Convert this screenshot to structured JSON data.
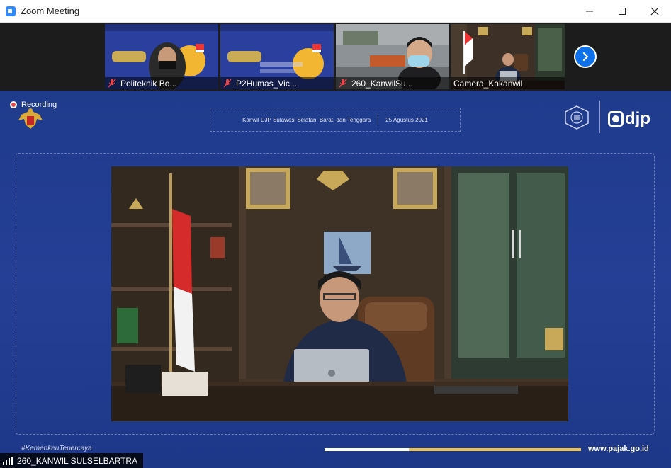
{
  "window": {
    "title": "Zoom Meeting",
    "controls": [
      "minimize",
      "maximize",
      "close"
    ]
  },
  "thumbnails": [
    {
      "name": "Politeknik Bo...",
      "muted": true
    },
    {
      "name": "P2Humas_Vic...",
      "muted": true
    },
    {
      "name": "260_KanwilSu...",
      "muted": true
    },
    {
      "name": "Camera_Kakanwil",
      "muted": false
    }
  ],
  "recording": {
    "label": "Recording"
  },
  "banner": {
    "office": "Kanwil DJP Sulawesi Selatan, Barat, dan Tenggara",
    "date": "25 Agustus 2021"
  },
  "brand": {
    "logo_text": "djp"
  },
  "footer": {
    "hashtag": "#KemenkeuTepercaya",
    "website": "www.pajak.go.id",
    "progress_fraction": 0.33
  },
  "active_speaker": {
    "name": "260_KANWIL SULSELBARTRA"
  },
  "colors": {
    "zoom_blue": "#2D8CFF",
    "background_blue": "#243f95",
    "accent_yellow": "#e8c04a",
    "mute_red": "#e5484d"
  }
}
